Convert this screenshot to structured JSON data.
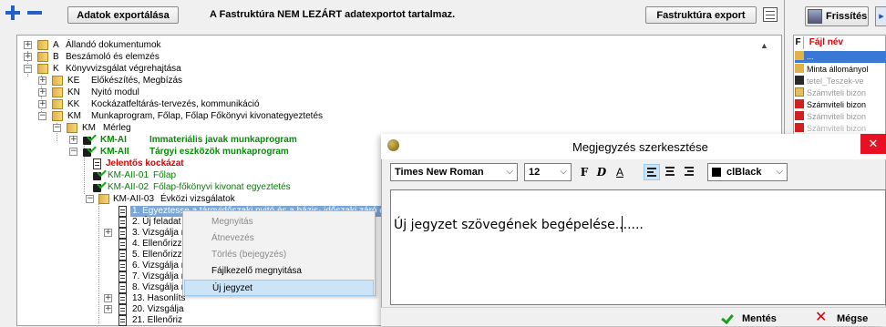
{
  "toolbar": {
    "export_label": "Adatok exportálása",
    "message": "A Fastruktúra NEM LEZÁRT adatexportot tartalmaz.",
    "fastruktura_export_label": "Fastruktúra export"
  },
  "tree": {
    "rows": [
      {
        "code": "A",
        "label": "Állandó dokumentumok"
      },
      {
        "code": "B",
        "label": "Beszámoló és elemzés"
      },
      {
        "code": "K",
        "label": "Könyvvizsgálat végrehajtása"
      },
      {
        "code": "KE",
        "label": "Előkészítés, Megbízás"
      },
      {
        "code": "KN",
        "label": "Nyitó modul"
      },
      {
        "code": "KK",
        "label": "Kockázatfeltárás-tervezés, kommunikáció"
      },
      {
        "code": "KM",
        "label": "Munkaprogram, Főlap, Főlap Főkönyvi kivonategyeztetés"
      },
      {
        "code": "KM",
        "label": "Mérleg"
      },
      {
        "code": "KM-AI",
        "label": "Immateriális javak munkaprogram"
      },
      {
        "code": "KM-AII",
        "label": "Tárgyi eszközök munkaprogram"
      },
      {
        "code": "",
        "label": "Jelentős kockázat"
      },
      {
        "code": "KM-AII-01",
        "label": "Főlap"
      },
      {
        "code": "KM-AII-02",
        "label": "Főlap-főkönyvi kivonat egyeztetés"
      },
      {
        "code": "KM-AII-03",
        "label": "Évközi vizsgálatok"
      },
      {
        "code": "",
        "label": "1. Egyeztesse a tárgyidőszaki nyitó és a bázis- időszaki záró esz"
      },
      {
        "code": "",
        "label": "2. Új feladat"
      },
      {
        "code": "",
        "label": "3. Vizsgálja r"
      },
      {
        "code": "",
        "label": "4. Ellenőrizze"
      },
      {
        "code": "",
        "label": "5. Ellenőrizze"
      },
      {
        "code": "",
        "label": "6. Vizsgálja r"
      },
      {
        "code": "",
        "label": "7. Vizsgálja r"
      },
      {
        "code": "",
        "label": "8. Vizsgálja r"
      },
      {
        "code": "",
        "label": "13. Hasonlíts"
      },
      {
        "code": "",
        "label": "20. Vizsgálja"
      },
      {
        "code": "",
        "label": "21. Ellenőriz"
      }
    ]
  },
  "context_menu": {
    "items": [
      {
        "label": "Megnyitás"
      },
      {
        "label": "Átnevezés"
      },
      {
        "label": "Törlés (bejegyzés)"
      },
      {
        "label": "Fájlkezelő megnyitása"
      },
      {
        "label": "Új jegyzet"
      }
    ]
  },
  "right_panel": {
    "refresh_label": "Frissítés",
    "col_f": "F",
    "col_name": "Fájl név",
    "files": [
      {
        "name": "..."
      },
      {
        "name": "Minta állományol"
      },
      {
        "name": "tetel_Teszek-ve"
      },
      {
        "name": "Számviteli bizon"
      },
      {
        "name": "Számviteli bizon"
      },
      {
        "name": "Számviteli bizon"
      },
      {
        "name": "Számviteli bizon"
      }
    ]
  },
  "dialog": {
    "title": "Megjegyzés szerkesztése",
    "close_glyph": "✕",
    "font": "Times New Roman",
    "size": "12",
    "bold": "F",
    "italic": "D",
    "underline": "A",
    "color": "clBlack",
    "body_text": "Új jegyzet szövegének begépelése.......",
    "save_label": "Mentés",
    "cancel_label": "Mégse"
  },
  "colors": {
    "selection": "#7aa6d8",
    "green_text": "#0a8a0a",
    "red_text": "#e00000",
    "close_red": "#e81123"
  }
}
